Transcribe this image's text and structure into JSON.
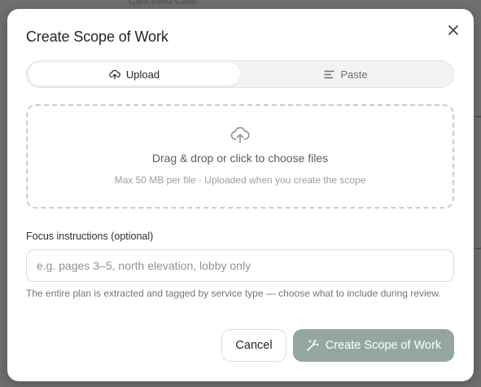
{
  "background": {
    "peek_text": "Cancelled Calls"
  },
  "dialog": {
    "title": "Create Scope of Work",
    "close_icon": "close-icon"
  },
  "tabs": [
    {
      "label": "Upload",
      "icon": "upload-cloud-icon",
      "active": true
    },
    {
      "label": "Paste",
      "icon": "text-lines-icon",
      "active": false
    }
  ],
  "dropzone": {
    "icon": "upload-cloud-icon",
    "primary": "Drag & drop or click to choose files",
    "secondary": "Max 50 MB per file · Uploaded when you create the scope"
  },
  "focus": {
    "label": "Focus instructions (optional)",
    "value": "",
    "placeholder": "e.g. pages 3–5, north elevation, lobby only"
  },
  "helper_text": "The entire plan is extracted and tagged by service type — choose what to include during review.",
  "actions": {
    "cancel_label": "Cancel",
    "create_label": "Create Scope of Work",
    "create_icon": "magic-wand-icon"
  },
  "colors": {
    "primary_button": "#93a7a1",
    "dialog_bg": "#ffffff",
    "backdrop": "#707070"
  }
}
